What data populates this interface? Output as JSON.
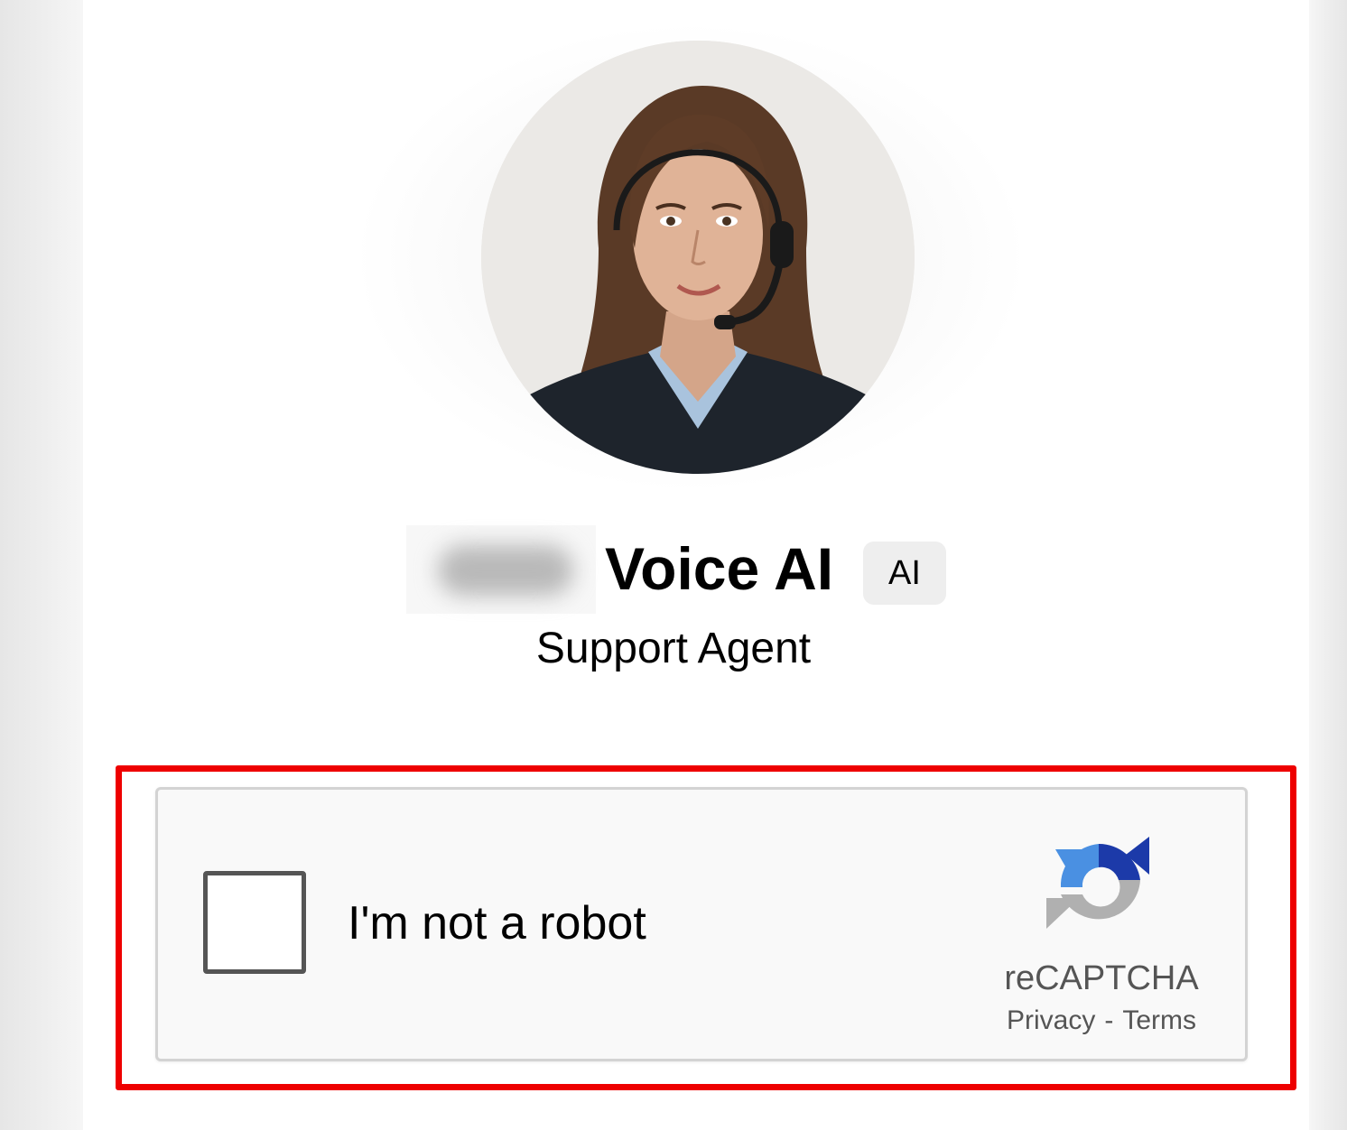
{
  "agent": {
    "name": "Voice AI",
    "badge": "AI",
    "role": "Support Agent",
    "avatar_icon": "agent-photo-with-headset",
    "name_prefix_state": "blurred"
  },
  "recaptcha": {
    "checkbox_checked": false,
    "label": "I'm not a robot",
    "brand": "reCAPTCHA",
    "privacy_link": "Privacy",
    "separator": "-",
    "terms_link": "Terms",
    "logo_icon": "recaptcha-logo-icon",
    "colors": {
      "blue_dark": "#1c3aa9",
      "blue_light": "#4a90e2",
      "gray": "#b0b0b0"
    }
  },
  "highlight": {
    "color": "#ee0000"
  }
}
